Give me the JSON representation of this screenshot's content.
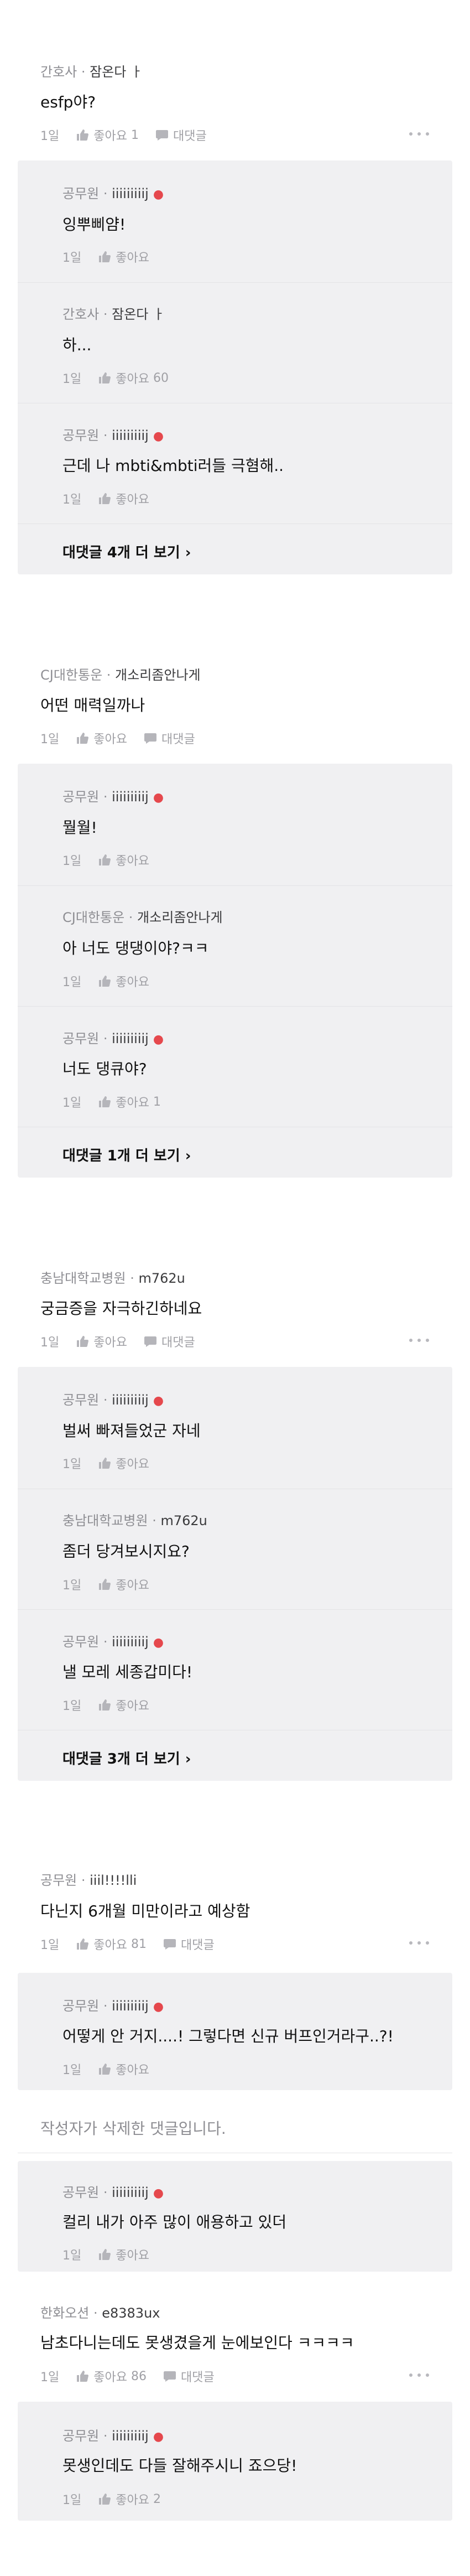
{
  "action_labels": {
    "like": "좋아요",
    "reply": "대댓글",
    "more_replies_suffix": "개 더 보기"
  },
  "threads": [
    {
      "comment": {
        "company": "간호사",
        "nickname": "잠온다 ㅏ",
        "text": "esfp야?",
        "time": "1일",
        "likes": "1"
      },
      "replies": [
        {
          "company": "공무원",
          "nickname": "iiiiiiiiij",
          "author": true,
          "text": "잉뿌삐얌!",
          "time": "1일",
          "likes": ""
        },
        {
          "company": "간호사",
          "nickname": "잠온다 ㅏ",
          "author": false,
          "text": "하...",
          "time": "1일",
          "likes": "60"
        },
        {
          "company": "공무원",
          "nickname": "iiiiiiiiij",
          "author": true,
          "text": "근데 나 mbti&mbti러들 극혐해..",
          "time": "1일",
          "likes": ""
        }
      ],
      "more_replies": "대댓글 4개 더 보기"
    },
    {
      "comment": {
        "company": "CJ대한통운",
        "nickname": "개소리좀안나게",
        "text": "어떤 매력일까나",
        "time": "1일",
        "likes": ""
      },
      "replies": [
        {
          "company": "공무원",
          "nickname": "iiiiiiiiij",
          "author": true,
          "text": "뭘월!",
          "time": "1일",
          "likes": ""
        },
        {
          "company": "CJ대한통운",
          "nickname": "개소리좀안나게",
          "author": false,
          "text": "아 너도 댕댕이야?ㅋㅋ",
          "time": "1일",
          "likes": ""
        },
        {
          "company": "공무원",
          "nickname": "iiiiiiiiij",
          "author": true,
          "text": "너도 댕큐야?",
          "time": "1일",
          "likes": "1"
        }
      ],
      "more_replies": "대댓글 1개 더 보기"
    },
    {
      "comment": {
        "company": "충남대학교병원",
        "nickname": "m762u",
        "text": "궁금증을 자극하긴하네요",
        "time": "1일",
        "likes": ""
      },
      "replies": [
        {
          "company": "공무원",
          "nickname": "iiiiiiiiij",
          "author": true,
          "text": "벌써 빠져들었군 자네",
          "time": "1일",
          "likes": ""
        },
        {
          "company": "충남대학교병원",
          "nickname": "m762u",
          "author": false,
          "text": "좀더 당겨보시지요?",
          "time": "1일",
          "likes": ""
        },
        {
          "company": "공무원",
          "nickname": "iiiiiiiiij",
          "author": true,
          "text": "낼 모레 세종갑미다!",
          "time": "1일",
          "likes": ""
        }
      ],
      "more_replies": "대댓글 3개 더 보기"
    },
    {
      "comment": {
        "company": "공무원",
        "nickname": "iiil!!!!lli",
        "text": "다닌지 6개월 미만이라고 예상함",
        "time": "1일",
        "likes": "81"
      },
      "replies": [
        {
          "company": "공무원",
          "nickname": "iiiiiiiiij",
          "author": true,
          "text": "어떻게 안 거지....! 그렇다면 신규 버프인거라구..?!",
          "time": "1일",
          "likes": ""
        }
      ],
      "more_replies": ""
    }
  ],
  "deleted_comment": "작성자가 삭제한 댓글입니다.",
  "orphan_reply": {
    "company": "공무원",
    "nickname": "iiiiiiiiij",
    "author": true,
    "text": "컬리 내가 아주 많이 애용하고 있더",
    "time": "1일",
    "likes": ""
  },
  "last_thread": {
    "comment": {
      "company": "한화오션",
      "nickname": "e8383ux",
      "text": "남초다니는데도 못생겼을게 눈에보인다 ㅋㅋㅋㅋ",
      "time": "1일",
      "likes": "86"
    },
    "reply": {
      "company": "공무원",
      "nickname": "iiiiiiiiij",
      "author": true,
      "text": "못생인데도 다들 잘해주시니 죠으당!",
      "time": "1일",
      "likes": "2"
    }
  }
}
